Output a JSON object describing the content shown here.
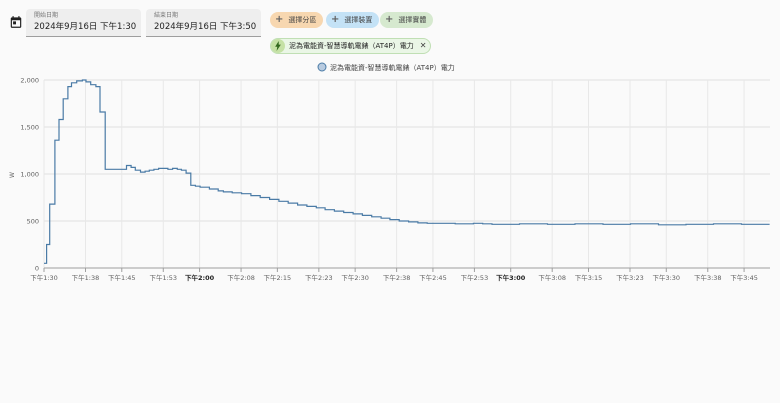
{
  "date_picker": {
    "icon": "calendar-icon",
    "start": {
      "label": "開始日期",
      "value": "2024年9月16日 下午1:30"
    },
    "end": {
      "label": "結束日期",
      "value": "2024年9月16日 下午3:50"
    }
  },
  "target_picker": {
    "add_area": "選擇分區",
    "add_device": "選擇裝置",
    "add_entity": "選擇實體",
    "selected_entity": {
      "label": "泥為電能資-智慧導軌電錶（AT4P）電力",
      "icon": "flash-icon",
      "remove_icon": "close-icon"
    }
  },
  "colors": {
    "line": "#4a7ba6",
    "area_chip": "#f7d7b0",
    "device_chip": "#c4e2f6",
    "entity_chip": "#d6e9cf"
  },
  "chart_data": {
    "type": "line",
    "step": true,
    "legend": "泥為電能資-智慧導軌電錶（AT4P）電力",
    "legend_position": "top-center",
    "ylabel": "W",
    "ylim": [
      0,
      2000
    ],
    "yticks": [
      "0",
      "500",
      "1,000",
      "1,500",
      "2,000"
    ],
    "xlim": [
      0,
      140
    ],
    "grid": true,
    "xticks": [
      {
        "m": 0,
        "label": "下午1:30",
        "bold": false
      },
      {
        "m": 8,
        "label": "下午1:38",
        "bold": false
      },
      {
        "m": 15,
        "label": "下午1:45",
        "bold": false
      },
      {
        "m": 23,
        "label": "下午1:53",
        "bold": false
      },
      {
        "m": 30,
        "label": "下午2:00",
        "bold": true
      },
      {
        "m": 38,
        "label": "下午2:08",
        "bold": false
      },
      {
        "m": 45,
        "label": "下午2:15",
        "bold": false
      },
      {
        "m": 53,
        "label": "下午2:23",
        "bold": false
      },
      {
        "m": 60,
        "label": "下午2:30",
        "bold": false
      },
      {
        "m": 68,
        "label": "下午2:38",
        "bold": false
      },
      {
        "m": 75,
        "label": "下午2:45",
        "bold": false
      },
      {
        "m": 83,
        "label": "下午2:53",
        "bold": false
      },
      {
        "m": 90,
        "label": "下午3:00",
        "bold": true
      },
      {
        "m": 98,
        "label": "下午3:08",
        "bold": false
      },
      {
        "m": 105,
        "label": "下午3:15",
        "bold": false
      },
      {
        "m": 113,
        "label": "下午3:23",
        "bold": false
      },
      {
        "m": 120,
        "label": "下午3:30",
        "bold": false
      },
      {
        "m": 128,
        "label": "下午3:38",
        "bold": false
      },
      {
        "m": 135,
        "label": "下午3:45",
        "bold": false
      }
    ],
    "series": [
      {
        "name": "泥為電能資-智慧導軌電錶（AT4P）電力",
        "x": [
          0,
          0.5,
          1.1,
          2.1,
          2.9,
          3.7,
          4.6,
          5.3,
          6.3,
          7.4,
          8.1,
          9.0,
          10.0,
          10.8,
          11.8,
          12.6,
          13.6,
          15.9,
          16.8,
          17.6,
          18.6,
          19.5,
          20.3,
          21.2,
          22.1,
          23.0,
          23.9,
          24.8,
          25.7,
          26.5,
          27.4,
          28.3,
          29.2,
          30.1,
          31.9,
          33.6,
          34.6,
          36.3,
          38.1,
          39.9,
          41.7,
          43.5,
          45.3,
          47.1,
          48.9,
          50.7,
          52.5,
          54.2,
          56.0,
          57.8,
          59.6,
          61.4,
          63.2,
          65.0,
          66.7,
          68.5,
          70.3,
          72.1,
          73.9,
          75.7,
          77.5,
          79.3,
          81.1,
          82.8,
          84.6,
          86.4,
          91.7,
          97.1,
          102.4,
          107.8,
          113.1,
          118.5,
          123.8,
          129.1,
          134.5,
          139.8
        ],
        "y": [
          50,
          250,
          680,
          1360,
          1580,
          1800,
          1930,
          1970,
          1990,
          2000,
          1980,
          1950,
          1930,
          1660,
          1050,
          1050,
          1050,
          1090,
          1070,
          1040,
          1020,
          1030,
          1040,
          1050,
          1060,
          1060,
          1050,
          1060,
          1050,
          1040,
          1010,
          880,
          870,
          860,
          840,
          820,
          810,
          800,
          790,
          770,
          750,
          730,
          710,
          690,
          670,
          655,
          640,
          620,
          605,
          590,
          575,
          560,
          545,
          530,
          515,
          500,
          490,
          480,
          475,
          475,
          475,
          470,
          470,
          475,
          470,
          465,
          470,
          465,
          470,
          465,
          470,
          460,
          465,
          470,
          465,
          470
        ]
      }
    ]
  }
}
